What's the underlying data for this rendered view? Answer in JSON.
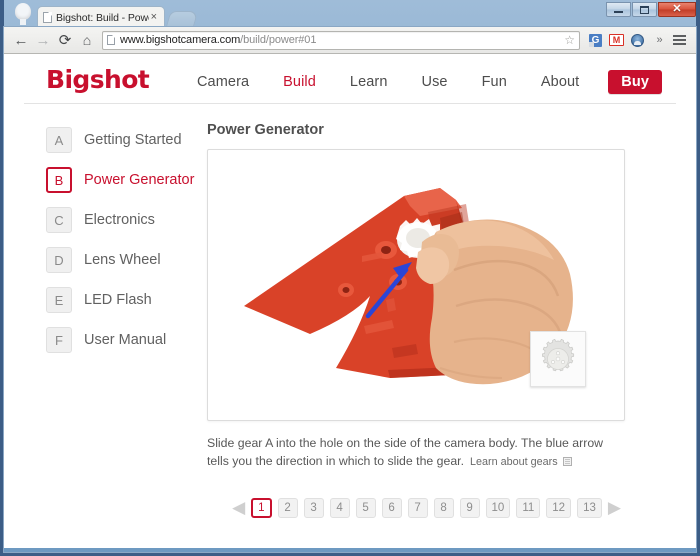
{
  "browser": {
    "tab": {
      "title": "Bigshot: Build - Power",
      "close_label": "×"
    },
    "new_tab_label": "",
    "nav": {
      "back": "←",
      "forward": "→",
      "reload": "⟳",
      "home": "⌂"
    },
    "omnibox": {
      "url_domain": "www.bigshotcamera.com",
      "url_path": "/build/power#01",
      "star": "☆"
    },
    "extensions": [
      {
        "name": "google-translate-icon",
        "label": "G"
      },
      {
        "name": "gmail-icon",
        "label": "M"
      },
      {
        "name": "user-account-icon",
        "label": ""
      },
      {
        "name": "overflow-icon",
        "label": "»"
      },
      {
        "name": "chrome-menu-icon",
        "label": ""
      }
    ],
    "window_controls": {
      "minimize": "–",
      "maximize": "□",
      "close": "✕"
    }
  },
  "site": {
    "brand": "Bigshot",
    "nav": [
      {
        "label": "Camera",
        "active": false
      },
      {
        "label": "Build",
        "active": true
      },
      {
        "label": "Learn",
        "active": false
      },
      {
        "label": "Use",
        "active": false
      },
      {
        "label": "Fun",
        "active": false
      },
      {
        "label": "About",
        "active": false
      }
    ],
    "buy_label": "Buy",
    "accent_color": "#c8102e"
  },
  "sidebar": {
    "items": [
      {
        "badge": "A",
        "label": "Getting Started",
        "active": false
      },
      {
        "badge": "B",
        "label": "Power Generator",
        "active": true
      },
      {
        "badge": "C",
        "label": "Electronics",
        "active": false
      },
      {
        "badge": "D",
        "label": "Lens Wheel",
        "active": false
      },
      {
        "badge": "E",
        "label": "LED Flash",
        "active": false
      },
      {
        "badge": "F",
        "label": "User Manual",
        "active": false
      }
    ]
  },
  "main": {
    "title": "Power Generator",
    "photo": {
      "alt": "Hand holding red camera body half while inserting white gear A",
      "arrow_color": "#2b45d6",
      "body_color": "#d6402a",
      "thumbnail_name": "gear-thumbnail"
    },
    "caption_text": "Slide gear A into the hole on the side of the camera body. The blue arrow tells you the direction in which to slide the gear.",
    "caption_link": "Learn about gears",
    "pagination": {
      "prev": "◀",
      "next": "▶",
      "pages": [
        "1",
        "2",
        "3",
        "4",
        "5",
        "6",
        "7",
        "8",
        "9",
        "10",
        "11",
        "12",
        "13"
      ],
      "active": "1"
    }
  }
}
